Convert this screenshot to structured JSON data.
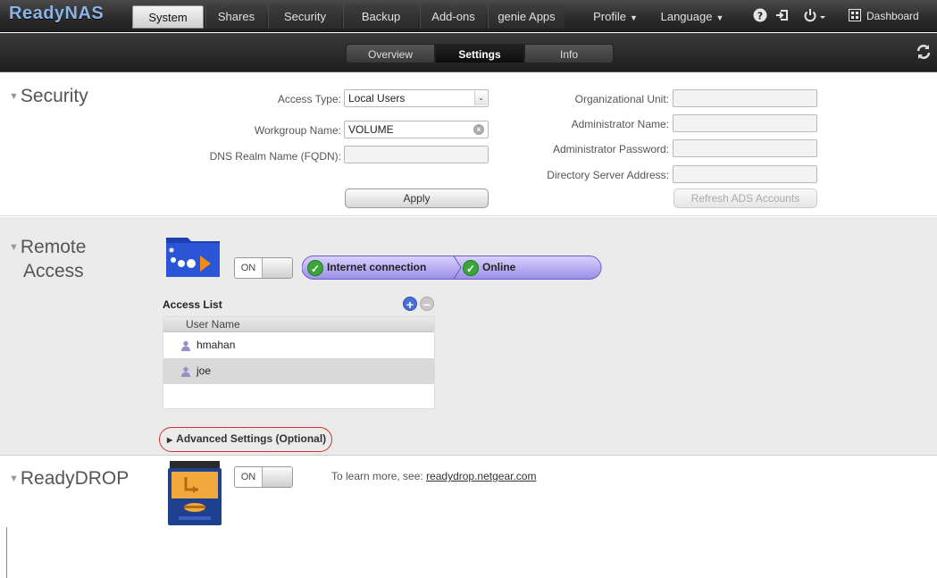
{
  "topnav": {
    "logo": "ReadyNAS",
    "tabs": [
      "System",
      "Shares",
      "Security",
      "Backup",
      "Add-ons",
      "genie Apps"
    ],
    "active_tab": "System",
    "profile_label": "Profile",
    "language_label": "Language",
    "dashboard_label": "Dashboard"
  },
  "subnav": {
    "tabs": [
      "Overview",
      "Settings",
      "Info"
    ],
    "active_tab": "Settings"
  },
  "security": {
    "title": "Security",
    "access_type_label": "Access Type:",
    "access_type_value": "Local Users",
    "workgroup_label": "Workgroup Name:",
    "workgroup_value": "VOLUME",
    "dns_realm_label": "DNS Realm Name (FQDN):",
    "dns_realm_value": "",
    "apply_label": "Apply",
    "org_unit_label": "Organizational Unit:",
    "admin_name_label": "Administrator Name:",
    "admin_password_label": "Administrator Password:",
    "dir_server_label": "Directory Server Address:",
    "refresh_ads_label": "Refresh ADS Accounts"
  },
  "remote_access": {
    "title_line1": "Remote",
    "title_line2": "Access",
    "toggle_label": "ON",
    "status_internet": "Internet connection",
    "status_online": "Online",
    "access_list_label": "Access List",
    "column_header": "User Name",
    "users": [
      "hmahan",
      "joe"
    ],
    "advanced_label": "Advanced Settings (Optional)"
  },
  "readydrop": {
    "title": "ReadyDROP",
    "toggle_label": "ON",
    "learn_text": "To learn more, see:",
    "learn_link": "readydrop.netgear.com"
  }
}
